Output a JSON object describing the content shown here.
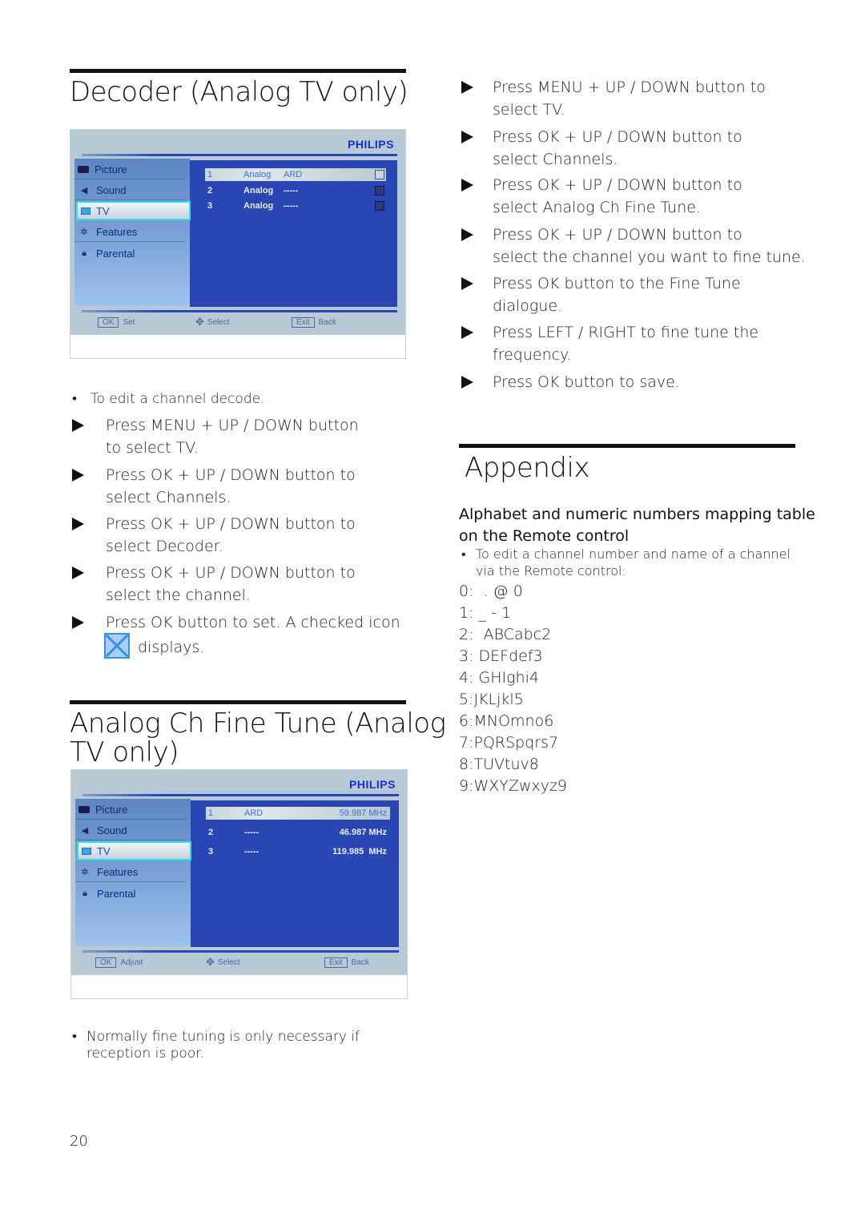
{
  "left": {
    "decoder": {
      "title": "Decoder (Analog TV only)",
      "screen": {
        "brand": "PHILIPS",
        "menu": [
          "Picture",
          "Sound",
          "TV",
          "Features",
          "Parental"
        ],
        "active_menu": "TV",
        "channels": [
          {
            "num": "1",
            "type": "Analog",
            "name": "ARD",
            "checked": false
          },
          {
            "num": "2",
            "type": "Analog",
            "name": "-----",
            "checked": false
          },
          {
            "num": "3",
            "type": "Analog",
            "name": "-----",
            "checked": false
          }
        ],
        "hints": [
          {
            "key": "OK",
            "label": "Set"
          },
          {
            "key": "",
            "label": "Select"
          },
          {
            "key": "Exit",
            "label": "Back"
          }
        ]
      },
      "note": "To edit a channel decode.",
      "steps": [
        "Press MENU + UP / DOWN button to select TV.",
        "Press OK + UP / DOWN button to select Channels.",
        "Press OK + UP / DOWN button to select Decoder.",
        "Press OK + UP / DOWN button to select the channel.",
        "Press OK button to set. A checked icon"
      ],
      "step_tail": "displays."
    },
    "finetune": {
      "title_line1": "Analog Ch Fine Tune (Analog",
      "title_line2": "TV only)",
      "screen": {
        "brand": "PHILIPS",
        "menu": [
          "Picture",
          "Sound",
          "TV",
          "Features",
          "Parental"
        ],
        "active_menu": "TV",
        "channels": [
          {
            "num": "1",
            "name": "ARD",
            "freq": "59.987 MHz"
          },
          {
            "num": "2",
            "name": "-----",
            "freq": "46.987 MHz"
          },
          {
            "num": "3",
            "name": "-----",
            "freq": "119.985  MHz"
          }
        ],
        "hints": [
          {
            "key": "OK",
            "label": "Adjust"
          },
          {
            "key": "",
            "label": "Select"
          },
          {
            "key": "Exit",
            "label": "Back"
          }
        ]
      },
      "note_line1": "Normally fine tuning is only necessary if",
      "note_line2": "reception is poor."
    },
    "page_number": "20"
  },
  "right": {
    "steps": [
      [
        "Press MENU + UP / DOWN button to",
        "select TV."
      ],
      [
        "Press OK + UP / DOWN button to",
        "select Channels."
      ],
      [
        "Press OK + UP / DOWN button to",
        "select Analog Ch Fine Tune."
      ],
      [
        "Press OK + UP / DOWN button to",
        "select the channel you want to fine tune."
      ],
      [
        "Press OK button to the Fine Tune",
        "dialogue."
      ],
      [
        "Press LEFT / RIGHT to fine tune the",
        "frequency."
      ],
      [
        "Press OK button to save."
      ]
    ],
    "appendix": {
      "title": "Appendix",
      "subtitle_line1": "Alphabet and numeric numbers mapping table",
      "subtitle_line2": "on the Remote control",
      "bullet_line1": "To edit a channel number and name of a channel",
      "bullet_line2": "via the Remote control:",
      "mapping": [
        "0:  . @ 0",
        "1: _ - 1",
        "2:  ABCabc2",
        "3: DEFdef3",
        "4: GHIghi4",
        "5:JKLjkl5",
        "6:MNOmno6",
        "7:PQRSpqrs7",
        "8:TUVtuv8",
        "9:WXYZwxyz9"
      ]
    }
  }
}
